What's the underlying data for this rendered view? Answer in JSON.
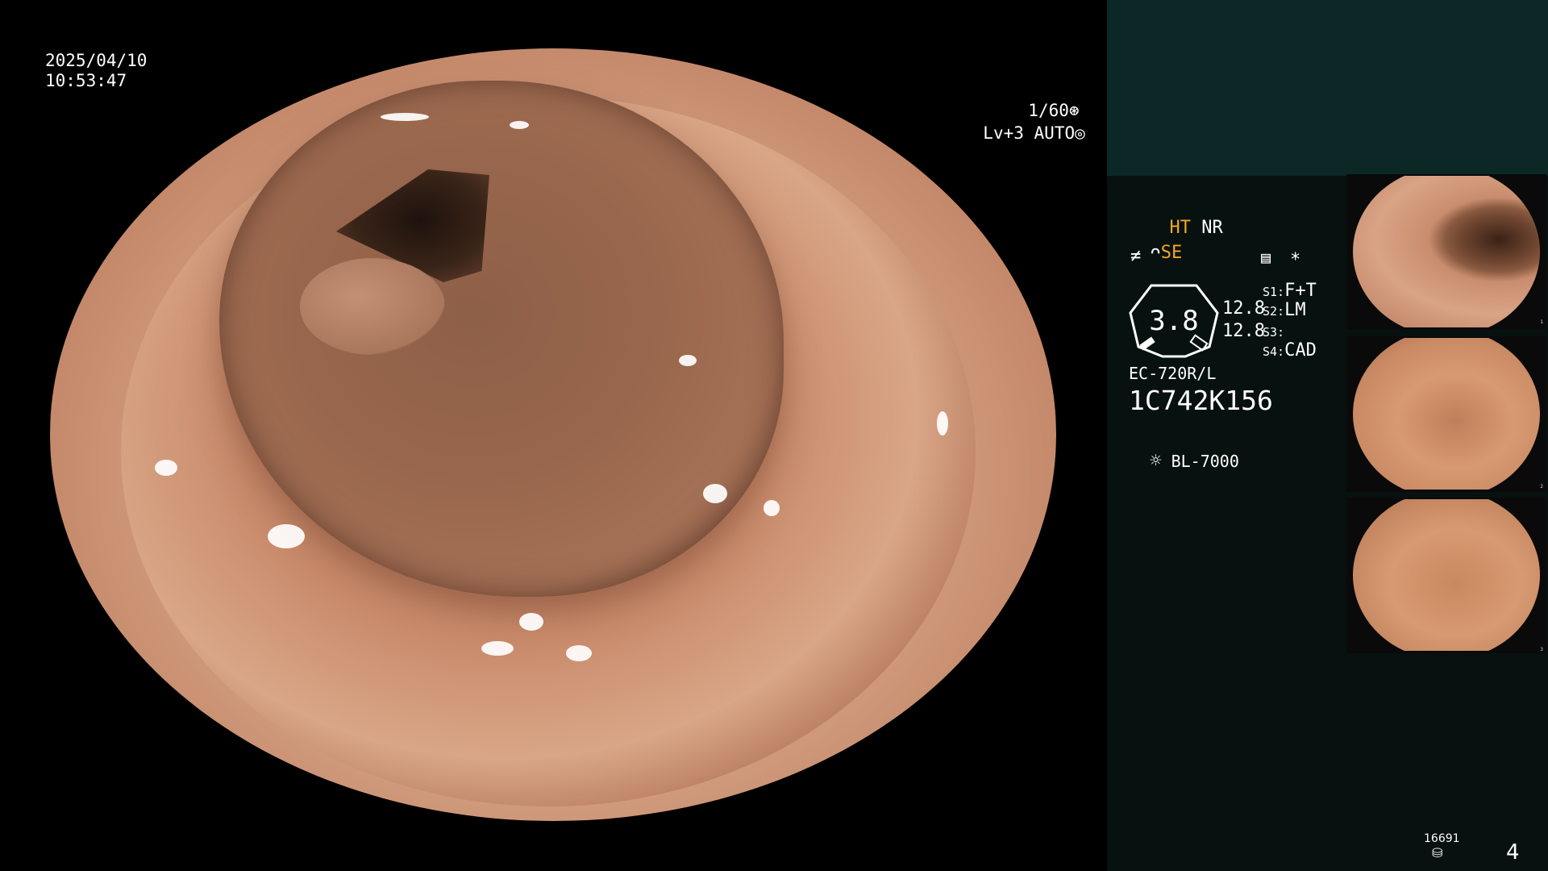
{
  "datetime": {
    "date": "2025/04/10",
    "time": "10:53:47"
  },
  "camera_info": {
    "shutter": "1/60",
    "shutter_icon": "aperture-icon",
    "level": "Lv+3",
    "mode": "AUTO",
    "mode_icon": "iris-icon"
  },
  "panel": {
    "ht": "HT",
    "nr": "NR",
    "se": "SE",
    "se_icon": "structure-enhance-icon",
    "filter_icon": "filter-icon",
    "menu_icon": "settings-grid-icon",
    "star": "*",
    "gauge_value": "3.8",
    "gauge_sub1": "12.8",
    "gauge_sub2": "12.8",
    "switches": [
      {
        "key": "S1:",
        "value": "F+T"
      },
      {
        "key": "S2:",
        "value": "LM"
      },
      {
        "key": "S3:",
        "value": ""
      },
      {
        "key": "S4:",
        "value": "CAD"
      }
    ],
    "scope_model": "EC-720R/L",
    "serial": "1C742K156",
    "light_icon": "light-source-icon",
    "light_source": "BL-7000",
    "counter": "16691",
    "counter_icon": "storage-icon",
    "page": "4"
  },
  "thumbnails": [
    {
      "index": "1"
    },
    {
      "index": "2"
    },
    {
      "index": "3"
    }
  ],
  "colors": {
    "accent_orange": "#f5a623",
    "panel_bg": "#07110f",
    "panel_top": "#0b2826",
    "mucosa": "#c88a68"
  }
}
